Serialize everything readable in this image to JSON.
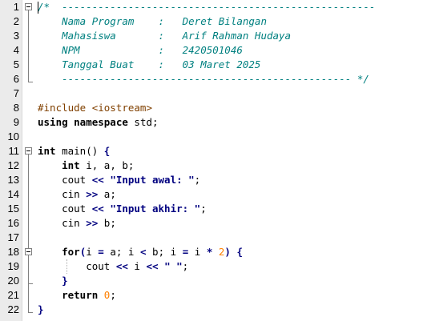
{
  "editor": {
    "lines": [
      {
        "n": "1",
        "tokens": [
          {
            "c": "cmt",
            "t": "/*  ----------------------------------------------------"
          }
        ]
      },
      {
        "n": "2",
        "tokens": [
          {
            "c": "cmt",
            "t": "    Nama Program    :   Deret Bilangan"
          }
        ]
      },
      {
        "n": "3",
        "tokens": [
          {
            "c": "cmt",
            "t": "    Mahasiswa       :   Arif Rahman Hudaya"
          }
        ]
      },
      {
        "n": "4",
        "tokens": [
          {
            "c": "cmt",
            "t": "    NPM             :   2420501046"
          }
        ]
      },
      {
        "n": "5",
        "tokens": [
          {
            "c": "cmt",
            "t": "    Tanggal Buat    :   03 Maret 2025"
          }
        ]
      },
      {
        "n": "6",
        "tokens": [
          {
            "c": "cmt",
            "t": "    ------------------------------------------------ */"
          }
        ]
      },
      {
        "n": "7",
        "tokens": []
      },
      {
        "n": "8",
        "tokens": [
          {
            "c": "pp",
            "t": "#include <iostream>"
          }
        ]
      },
      {
        "n": "9",
        "tokens": [
          {
            "c": "kw",
            "t": "using namespace "
          },
          {
            "c": "plain",
            "t": "std;"
          }
        ]
      },
      {
        "n": "10",
        "tokens": []
      },
      {
        "n": "11",
        "tokens": [
          {
            "c": "kw",
            "t": "int "
          },
          {
            "c": "plain",
            "t": "main() "
          },
          {
            "c": "op",
            "t": "{"
          }
        ]
      },
      {
        "n": "12",
        "tokens": [
          {
            "c": "plain",
            "t": "    "
          },
          {
            "c": "kw",
            "t": "int "
          },
          {
            "c": "plain",
            "t": "i, a, b;"
          }
        ]
      },
      {
        "n": "13",
        "tokens": [
          {
            "c": "plain",
            "t": "    cout "
          },
          {
            "c": "op",
            "t": "<< "
          },
          {
            "c": "strq",
            "t": "\"Input awal: \""
          },
          {
            "c": "plain",
            "t": ";"
          }
        ]
      },
      {
        "n": "14",
        "tokens": [
          {
            "c": "plain",
            "t": "    cin "
          },
          {
            "c": "op",
            "t": ">> "
          },
          {
            "c": "plain",
            "t": "a;"
          }
        ]
      },
      {
        "n": "15",
        "tokens": [
          {
            "c": "plain",
            "t": "    cout "
          },
          {
            "c": "op",
            "t": "<< "
          },
          {
            "c": "strq",
            "t": "\"Input akhir: \""
          },
          {
            "c": "plain",
            "t": ";"
          }
        ]
      },
      {
        "n": "16",
        "tokens": [
          {
            "c": "plain",
            "t": "    cin "
          },
          {
            "c": "op",
            "t": ">> "
          },
          {
            "c": "plain",
            "t": "b;"
          }
        ]
      },
      {
        "n": "17",
        "tokens": []
      },
      {
        "n": "18",
        "tokens": [
          {
            "c": "plain",
            "t": "    "
          },
          {
            "c": "kw",
            "t": "for"
          },
          {
            "c": "op",
            "t": "("
          },
          {
            "c": "plain",
            "t": "i "
          },
          {
            "c": "op",
            "t": "= "
          },
          {
            "c": "plain",
            "t": "a; i "
          },
          {
            "c": "op",
            "t": "< "
          },
          {
            "c": "plain",
            "t": "b; i "
          },
          {
            "c": "op",
            "t": "= "
          },
          {
            "c": "plain",
            "t": "i "
          },
          {
            "c": "op",
            "t": "* "
          },
          {
            "c": "num",
            "t": "2"
          },
          {
            "c": "op",
            "t": ") {"
          }
        ]
      },
      {
        "n": "19",
        "tokens": [
          {
            "c": "plain",
            "t": "        cout "
          },
          {
            "c": "op",
            "t": "<< "
          },
          {
            "c": "plain",
            "t": "i "
          },
          {
            "c": "op",
            "t": "<< "
          },
          {
            "c": "strq",
            "t": "\" \""
          },
          {
            "c": "plain",
            "t": ";"
          }
        ]
      },
      {
        "n": "20",
        "tokens": [
          {
            "c": "plain",
            "t": "    "
          },
          {
            "c": "op",
            "t": "}"
          }
        ]
      },
      {
        "n": "21",
        "tokens": [
          {
            "c": "plain",
            "t": "    "
          },
          {
            "c": "kw",
            "t": "return "
          },
          {
            "c": "num",
            "t": "0"
          },
          {
            "c": "plain",
            "t": ";"
          }
        ]
      },
      {
        "n": "22",
        "tokens": [
          {
            "c": "op",
            "t": "}"
          }
        ]
      }
    ]
  }
}
